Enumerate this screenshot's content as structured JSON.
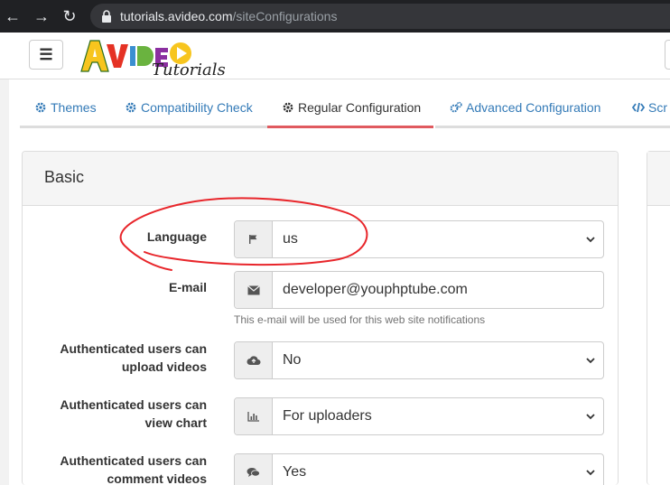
{
  "browser": {
    "url_host": "tutorials.avideo.com",
    "url_path": "/siteConfigurations"
  },
  "header": {
    "logo_text": "AVideo",
    "logo_sub": "Tutorials"
  },
  "tabs": [
    {
      "label": "Themes",
      "icon": "gear-icon"
    },
    {
      "label": "Compatibility Check",
      "icon": "gear-icon"
    },
    {
      "label": "Regular Configuration",
      "icon": "gear-icon",
      "active": true
    },
    {
      "label": "Advanced Configuration",
      "icon": "gears-icon"
    },
    {
      "label": "Scr",
      "icon": "code-icon"
    }
  ],
  "panel": {
    "title": "Basic"
  },
  "form": {
    "language": {
      "label": "Language",
      "value": "us",
      "icon": "flag-icon"
    },
    "email": {
      "label": "E-mail",
      "value": "developer@youphptube.com",
      "icon": "envelope-icon",
      "help": "This e-mail will be used for this web site notifications"
    },
    "upload": {
      "label_line1": "Authenticated users can",
      "label_line2": "upload videos",
      "value": "No",
      "icon": "cloud-upload-icon"
    },
    "chart": {
      "label_line1": "Authenticated users can",
      "label_line2": "view chart",
      "value": "For uploaders",
      "icon": "bar-chart-icon"
    },
    "comment": {
      "label_line1": "Authenticated users can",
      "label_line2": "comment videos",
      "value": "Yes",
      "icon": "comments-icon"
    }
  },
  "colors": {
    "annotation": "#e8262b",
    "link": "#337ab7",
    "active_tab_border": "#e05a5f"
  }
}
